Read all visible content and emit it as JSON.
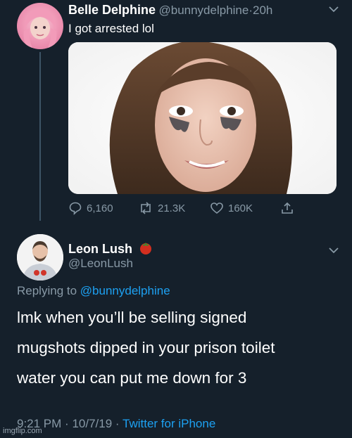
{
  "tweet1": {
    "name": "Belle Delphine",
    "handle": "@bunnydelphine",
    "separator": "·",
    "time": "20h",
    "text": "I got arrested lol",
    "reply_count": "6,160",
    "retweet_count": "21.3K",
    "like_count": "160K"
  },
  "tweet2": {
    "name": "Leon Lush",
    "handle": "@LeonLush",
    "replying_prefix": "Replying to",
    "replying_handle": "@bunnydelphine",
    "lines": [
      "lmk when you’ll be selling signed",
      "mugshots dipped in your prison toilet",
      "water you can put me down for 3"
    ],
    "time": "9:21 PM",
    "date": "10/7/19",
    "dot": "·",
    "source": "Twitter for iPhone"
  },
  "watermark": "imgflip.com",
  "colors": {
    "background": "#15202b",
    "secondary_text": "#8899a6",
    "link": "#1da1f2",
    "thread_line": "#3d5466"
  },
  "icons": [
    "reply-icon",
    "retweet-icon",
    "like-icon",
    "share-icon",
    "chevron-down-icon",
    "tomato-icon"
  ]
}
